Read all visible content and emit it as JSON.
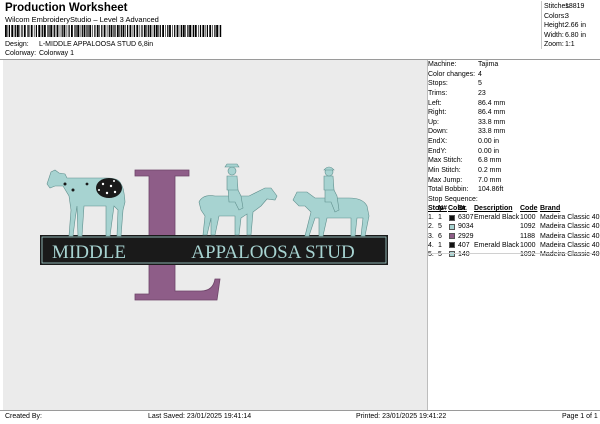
{
  "header": {
    "title": "Production Worksheet",
    "subtitle": "Wilcom EmbroideryStudio – Level 3 Advanced",
    "design_label": "Design:",
    "design_value": "L-MIDDLE APPALOOSA STUD 6,8in",
    "colorway_label": "Colorway:",
    "colorway_value": "Colorway 1"
  },
  "stats": [
    {
      "label": "Stitches:",
      "value": "18819"
    },
    {
      "label": "Colors:",
      "value": "3"
    },
    {
      "label": "Height:",
      "value": "2.66 in"
    },
    {
      "label": "Width:",
      "value": "6.80 in"
    },
    {
      "label": "Zoom:",
      "value": "1:1"
    }
  ],
  "machine_info": [
    {
      "label": "Machine:",
      "value": "Tajima"
    },
    {
      "label": "Color changes:",
      "value": "4"
    },
    {
      "label": "Stops:",
      "value": "5"
    },
    {
      "label": "Trims:",
      "value": "23"
    },
    {
      "label": "Left:",
      "value": "86.4 mm"
    },
    {
      "label": "Right:",
      "value": "86.4 mm"
    },
    {
      "label": "Up:",
      "value": "33.8 mm"
    },
    {
      "label": "Down:",
      "value": "33.8 mm"
    },
    {
      "label": "EndX:",
      "value": "0.00 in"
    },
    {
      "label": "EndY:",
      "value": "0.00 in"
    },
    {
      "label": "Max Stitch:",
      "value": "6.8 mm"
    },
    {
      "label": "Min Stitch:",
      "value": "0.2 mm"
    },
    {
      "label": "Max Jump:",
      "value": "7.0 mm"
    },
    {
      "label": "Total Bobbin:",
      "value": "104.86ft"
    }
  ],
  "stop_sequence": {
    "title": "Stop Sequence:",
    "headers": {
      "stop": "Stop",
      "num": "N#",
      "color": "Color",
      "st": "St.",
      "description": "Description",
      "code": "Code",
      "brand": "Brand"
    },
    "rows": [
      {
        "stop": "1.",
        "num": "1",
        "color": "#111111",
        "st": "6307",
        "description": "Emerald Black",
        "code": "1000",
        "brand": "Madeira Classic 40"
      },
      {
        "stop": "2.",
        "num": "5",
        "color": "#a7d3d1",
        "st": "9034",
        "description": "",
        "code": "1092",
        "brand": "Madeira Classic 40"
      },
      {
        "stop": "3.",
        "num": "6",
        "color": "#8e5d88",
        "st": "2929",
        "description": "",
        "code": "1188",
        "brand": "Madeira Classic 40"
      },
      {
        "stop": "4.",
        "num": "1",
        "color": "#111111",
        "st": "407",
        "description": "Emerald Black",
        "code": "1000",
        "brand": "Madeira Classic 40"
      },
      {
        "stop": "5.",
        "num": "5",
        "color": "#a7d3d1",
        "st": "140",
        "description": "",
        "code": "1092",
        "brand": "Madeira Classic 40"
      }
    ]
  },
  "design_preview": {
    "word_left": "MIDDLE",
    "word_right": "APPALOOSA STUD",
    "monogram": "L",
    "colors": {
      "mint": "#a7d3d1",
      "purple": "#8e5d88",
      "black": "#1a1a1a",
      "canvas": "#ebebeb"
    }
  },
  "footer": {
    "created_by": "Created By:",
    "last_saved": "Last Saved: 23/01/2025 19:41:14",
    "printed": "Printed: 23/01/2025 19:41:22",
    "page": "Page 1 of 1"
  }
}
